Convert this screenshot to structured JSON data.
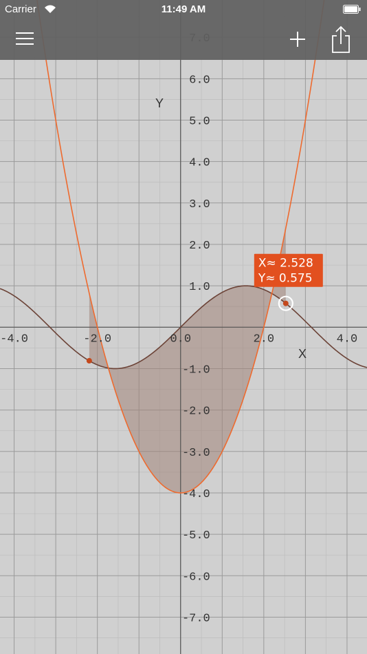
{
  "status_bar": {
    "carrier": "Carrier",
    "time": "11:49 AM"
  },
  "graph": {
    "x_axis_label": "X",
    "y_axis_label": "Y",
    "x_ticks": [
      {
        "v": -4,
        "label": "-4.0"
      },
      {
        "v": -2,
        "label": "-2.0"
      },
      {
        "v": 0,
        "label": "0.0"
      },
      {
        "v": 2,
        "label": "2.0"
      },
      {
        "v": 4,
        "label": "4.0"
      }
    ],
    "y_ticks": [
      {
        "v": 7,
        "label": "7.0"
      },
      {
        "v": 6,
        "label": "6.0"
      },
      {
        "v": 5,
        "label": "5.0"
      },
      {
        "v": 4,
        "label": "4.0"
      },
      {
        "v": 3,
        "label": "3.0"
      },
      {
        "v": 2,
        "label": "2.0"
      },
      {
        "v": 1,
        "label": "1.0"
      },
      {
        "v": -1,
        "label": "-1.0"
      },
      {
        "v": -2,
        "label": "-2.0"
      },
      {
        "v": -3,
        "label": "-3.0"
      },
      {
        "v": -4,
        "label": "-4.0"
      },
      {
        "v": -5,
        "label": "-5.0"
      },
      {
        "v": -6,
        "label": "-6.0"
      },
      {
        "v": -7,
        "label": "-7.0"
      }
    ],
    "x_range": [
      -4.34,
      4.48
    ],
    "y_range": [
      -7.89,
      7.9
    ],
    "functions": [
      {
        "id": "sine",
        "expr": "sin(x)",
        "color": "#6b4236"
      },
      {
        "id": "parabola",
        "expr": "x^2 - 4",
        "color": "#ee6a2e"
      }
    ],
    "shaded_region": {
      "between": [
        "sine",
        "parabola"
      ],
      "color": "#a08478"
    },
    "intersections": [
      {
        "x": -2.195,
        "y": -0.81,
        "marked": "dot"
      },
      {
        "x": 2.528,
        "y": 0.575,
        "marked": "selected"
      }
    ],
    "readout": {
      "x_text": "X≈  2.528",
      "y_text": "Y≈  0.575",
      "background": "#e2501f"
    }
  },
  "toolbar": {
    "menu_icon": "hamburger-menu-icon",
    "add_icon": "plus-icon",
    "share_icon": "share-icon"
  },
  "colors": {
    "background": "#d0d0d0",
    "grid_major": "#9a9a9a",
    "grid_minor": "#bdbdbd",
    "axis": "#555555",
    "toolbar": "#606060"
  }
}
